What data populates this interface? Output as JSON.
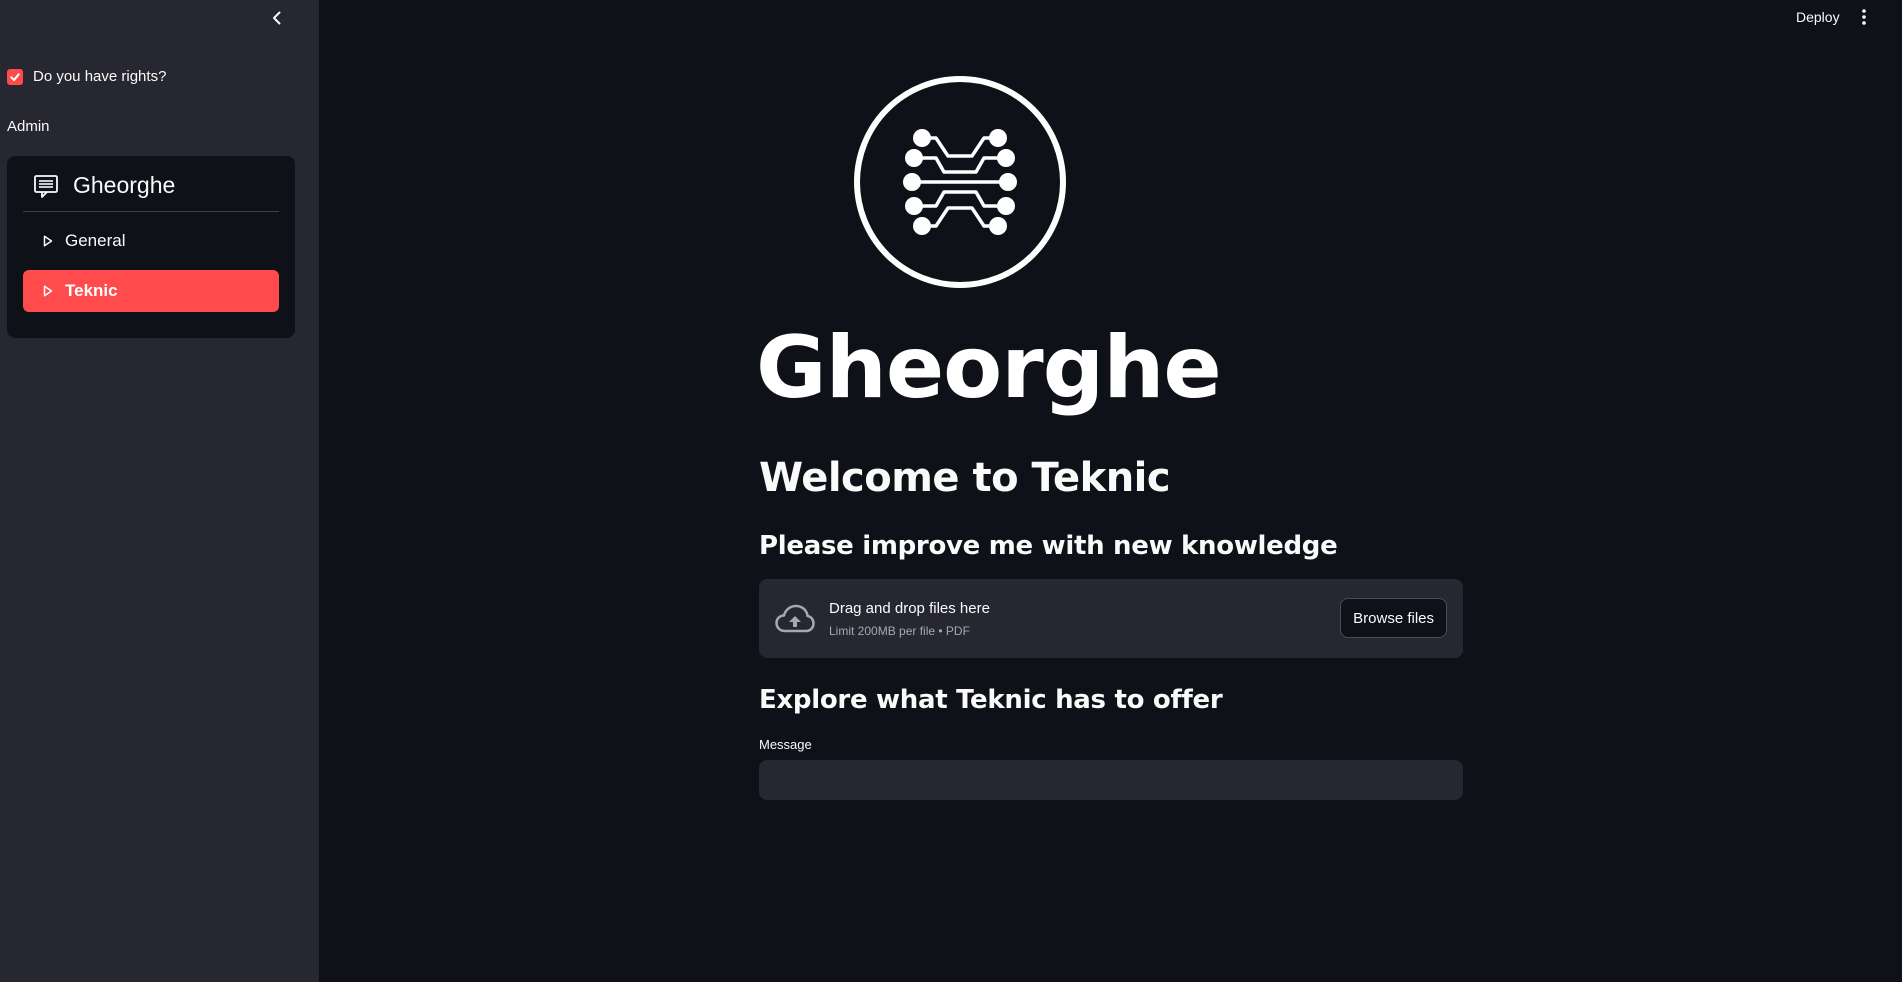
{
  "sidebar": {
    "rights_checkbox": {
      "label": "Do you have rights?",
      "checked": true
    },
    "admin_label": "Admin",
    "menu": {
      "title": "Gheorghe",
      "title_icon": "message-text-icon",
      "items": [
        {
          "label": "General",
          "icon": "play-outline-icon",
          "active": false
        },
        {
          "label": "Teknic",
          "icon": "play-outline-icon",
          "active": true
        }
      ]
    }
  },
  "topbar": {
    "deploy_label": "Deploy",
    "menu_icon": "kebab-menu-icon"
  },
  "main": {
    "logo_icon": "circuit-brain-icon",
    "brand_title": "Gheorghe",
    "heading": "Welcome to Teknic",
    "upload_heading": "Please improve me with new knowledge",
    "uploader": {
      "icon": "cloud-upload-icon",
      "main_text": "Drag and drop files here",
      "sub_text": "Limit 200MB per file • PDF",
      "button_label": "Browse files"
    },
    "explore_heading": "Explore what Teknic has to offer",
    "message": {
      "label": "Message",
      "value": "",
      "placeholder": ""
    }
  },
  "colors": {
    "accent": "#ff4b4b",
    "background": "#0e1117",
    "sidebar": "#262730",
    "text": "#fafafa"
  }
}
